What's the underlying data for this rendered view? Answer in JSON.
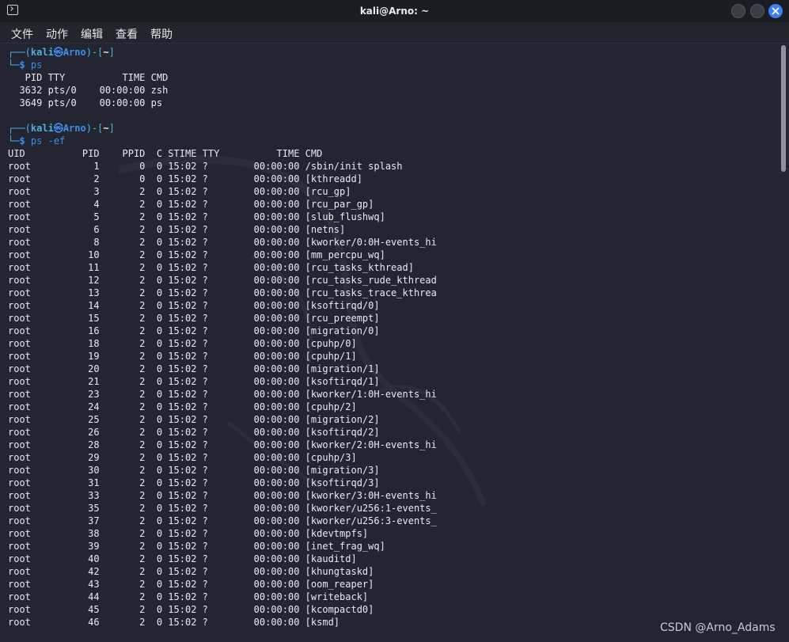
{
  "window": {
    "title": "kali@Arno: ~"
  },
  "menu": [
    "文件",
    "动作",
    "编辑",
    "查看",
    "帮助"
  ],
  "prompt": {
    "user": "kali",
    "host": "Arno",
    "dir": "~",
    "symbol": "$"
  },
  "commands": [
    "ps",
    "ps -ef"
  ],
  "ps_output": [
    "   PID TTY          TIME CMD",
    "  3632 pts/0    00:00:00 zsh",
    "  3649 pts/0    00:00:00 ps"
  ],
  "ps_ef_header": "UID          PID    PPID  C STIME TTY          TIME CMD",
  "ps_ef_rows": [
    "root           1       0  0 15:02 ?        00:00:00 /sbin/init splash",
    "root           2       0  0 15:02 ?        00:00:00 [kthreadd]",
    "root           3       2  0 15:02 ?        00:00:00 [rcu_gp]",
    "root           4       2  0 15:02 ?        00:00:00 [rcu_par_gp]",
    "root           5       2  0 15:02 ?        00:00:00 [slub_flushwq]",
    "root           6       2  0 15:02 ?        00:00:00 [netns]",
    "root           8       2  0 15:02 ?        00:00:00 [kworker/0:0H-events_hi",
    "root          10       2  0 15:02 ?        00:00:00 [mm_percpu_wq]",
    "root          11       2  0 15:02 ?        00:00:00 [rcu_tasks_kthread]",
    "root          12       2  0 15:02 ?        00:00:00 [rcu_tasks_rude_kthread",
    "root          13       2  0 15:02 ?        00:00:00 [rcu_tasks_trace_kthrea",
    "root          14       2  0 15:02 ?        00:00:00 [ksoftirqd/0]",
    "root          15       2  0 15:02 ?        00:00:00 [rcu_preempt]",
    "root          16       2  0 15:02 ?        00:00:00 [migration/0]",
    "root          18       2  0 15:02 ?        00:00:00 [cpuhp/0]",
    "root          19       2  0 15:02 ?        00:00:00 [cpuhp/1]",
    "root          20       2  0 15:02 ?        00:00:00 [migration/1]",
    "root          21       2  0 15:02 ?        00:00:00 [ksoftirqd/1]",
    "root          23       2  0 15:02 ?        00:00:00 [kworker/1:0H-events_hi",
    "root          24       2  0 15:02 ?        00:00:00 [cpuhp/2]",
    "root          25       2  0 15:02 ?        00:00:00 [migration/2]",
    "root          26       2  0 15:02 ?        00:00:00 [ksoftirqd/2]",
    "root          28       2  0 15:02 ?        00:00:00 [kworker/2:0H-events_hi",
    "root          29       2  0 15:02 ?        00:00:00 [cpuhp/3]",
    "root          30       2  0 15:02 ?        00:00:00 [migration/3]",
    "root          31       2  0 15:02 ?        00:00:00 [ksoftirqd/3]",
    "root          33       2  0 15:02 ?        00:00:00 [kworker/3:0H-events_hi",
    "root          35       2  0 15:02 ?        00:00:00 [kworker/u256:1-events_",
    "root          37       2  0 15:02 ?        00:00:00 [kworker/u256:3-events_",
    "root          38       2  0 15:02 ?        00:00:00 [kdevtmpfs]",
    "root          39       2  0 15:02 ?        00:00:00 [inet_frag_wq]",
    "root          40       2  0 15:02 ?        00:00:00 [kauditd]",
    "root          42       2  0 15:02 ?        00:00:00 [khungtaskd]",
    "root          43       2  0 15:02 ?        00:00:00 [oom_reaper]",
    "root          44       2  0 15:02 ?        00:00:00 [writeback]",
    "root          45       2  0 15:02 ?        00:00:00 [kcompactd0]",
    "root          46       2  0 15:02 ?        00:00:00 [ksmd]"
  ],
  "watermark": "CSDN @Arno_Adams",
  "colors": {
    "prompt_bracket": "#4cb0e8",
    "prompt_host": "#3f8ef0",
    "command": "#3f8ef0",
    "close_button": "#3d7ef1"
  }
}
